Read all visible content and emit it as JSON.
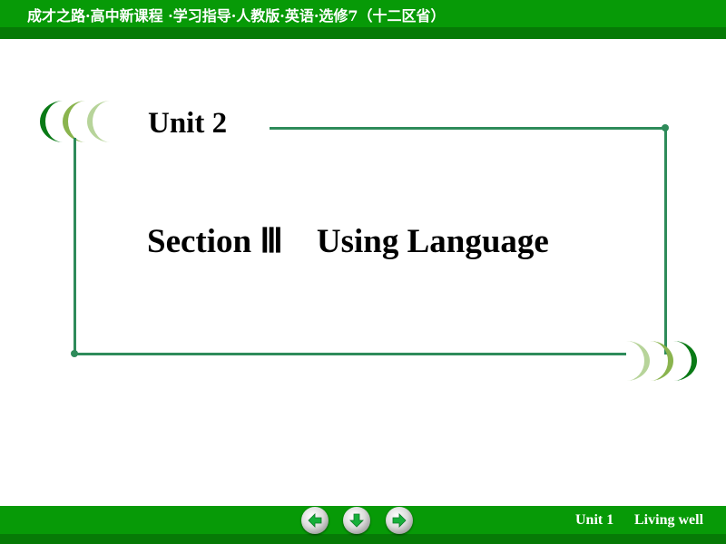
{
  "header": {
    "title": "成才之路·高中新课程 ·学习指导·人教版·英语·选修7（十二区省）"
  },
  "slide": {
    "unit_title": "Unit 2",
    "section_title": "Section Ⅲ    Using Language"
  },
  "footer": {
    "unit_label": "Unit 1",
    "unit_name": "Living well",
    "nav": {
      "prev_icon": "arrow-left-icon",
      "down_icon": "arrow-down-icon",
      "next_icon": "arrow-right-icon"
    }
  },
  "colors": {
    "header_green": "#079a07",
    "header_dark_green": "#067a06",
    "frame_line": "#2e8b5a",
    "crescent_dark": "#0a7a16",
    "crescent_mid": "#8ab44e",
    "crescent_light": "#b7d49a"
  }
}
